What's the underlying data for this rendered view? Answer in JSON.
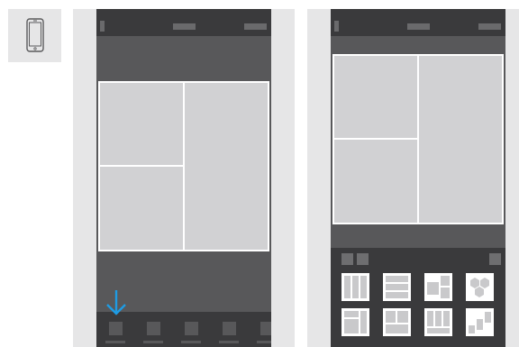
{
  "device_icon": "smartphone-icon",
  "colors": {
    "frame": "#3a3a3c",
    "content": "#58585a",
    "collage_cell": "#d1d1d3",
    "strip": "#e6e6e7",
    "accent": "#1e9be3"
  },
  "left_screen": {
    "tabs": [
      {
        "icon": "tab-icon"
      },
      {
        "icon": "tab-icon"
      },
      {
        "icon": "tab-icon"
      },
      {
        "icon": "tab-icon"
      },
      {
        "icon": "tab-icon"
      }
    ],
    "indicator_icon": "arrow-down-icon"
  },
  "right_screen": {
    "layouts": [
      {
        "icon": "layout-three-columns-icon"
      },
      {
        "icon": "layout-three-rows-icon"
      },
      {
        "icon": "layout-mixed-grid-icon"
      },
      {
        "icon": "layout-hexagons-icon"
      },
      {
        "icon": "layout-top-split-icon"
      },
      {
        "icon": "layout-bottom-split-icon"
      },
      {
        "icon": "layout-four-columns-icon"
      },
      {
        "icon": "layout-stairs-icon"
      }
    ]
  }
}
